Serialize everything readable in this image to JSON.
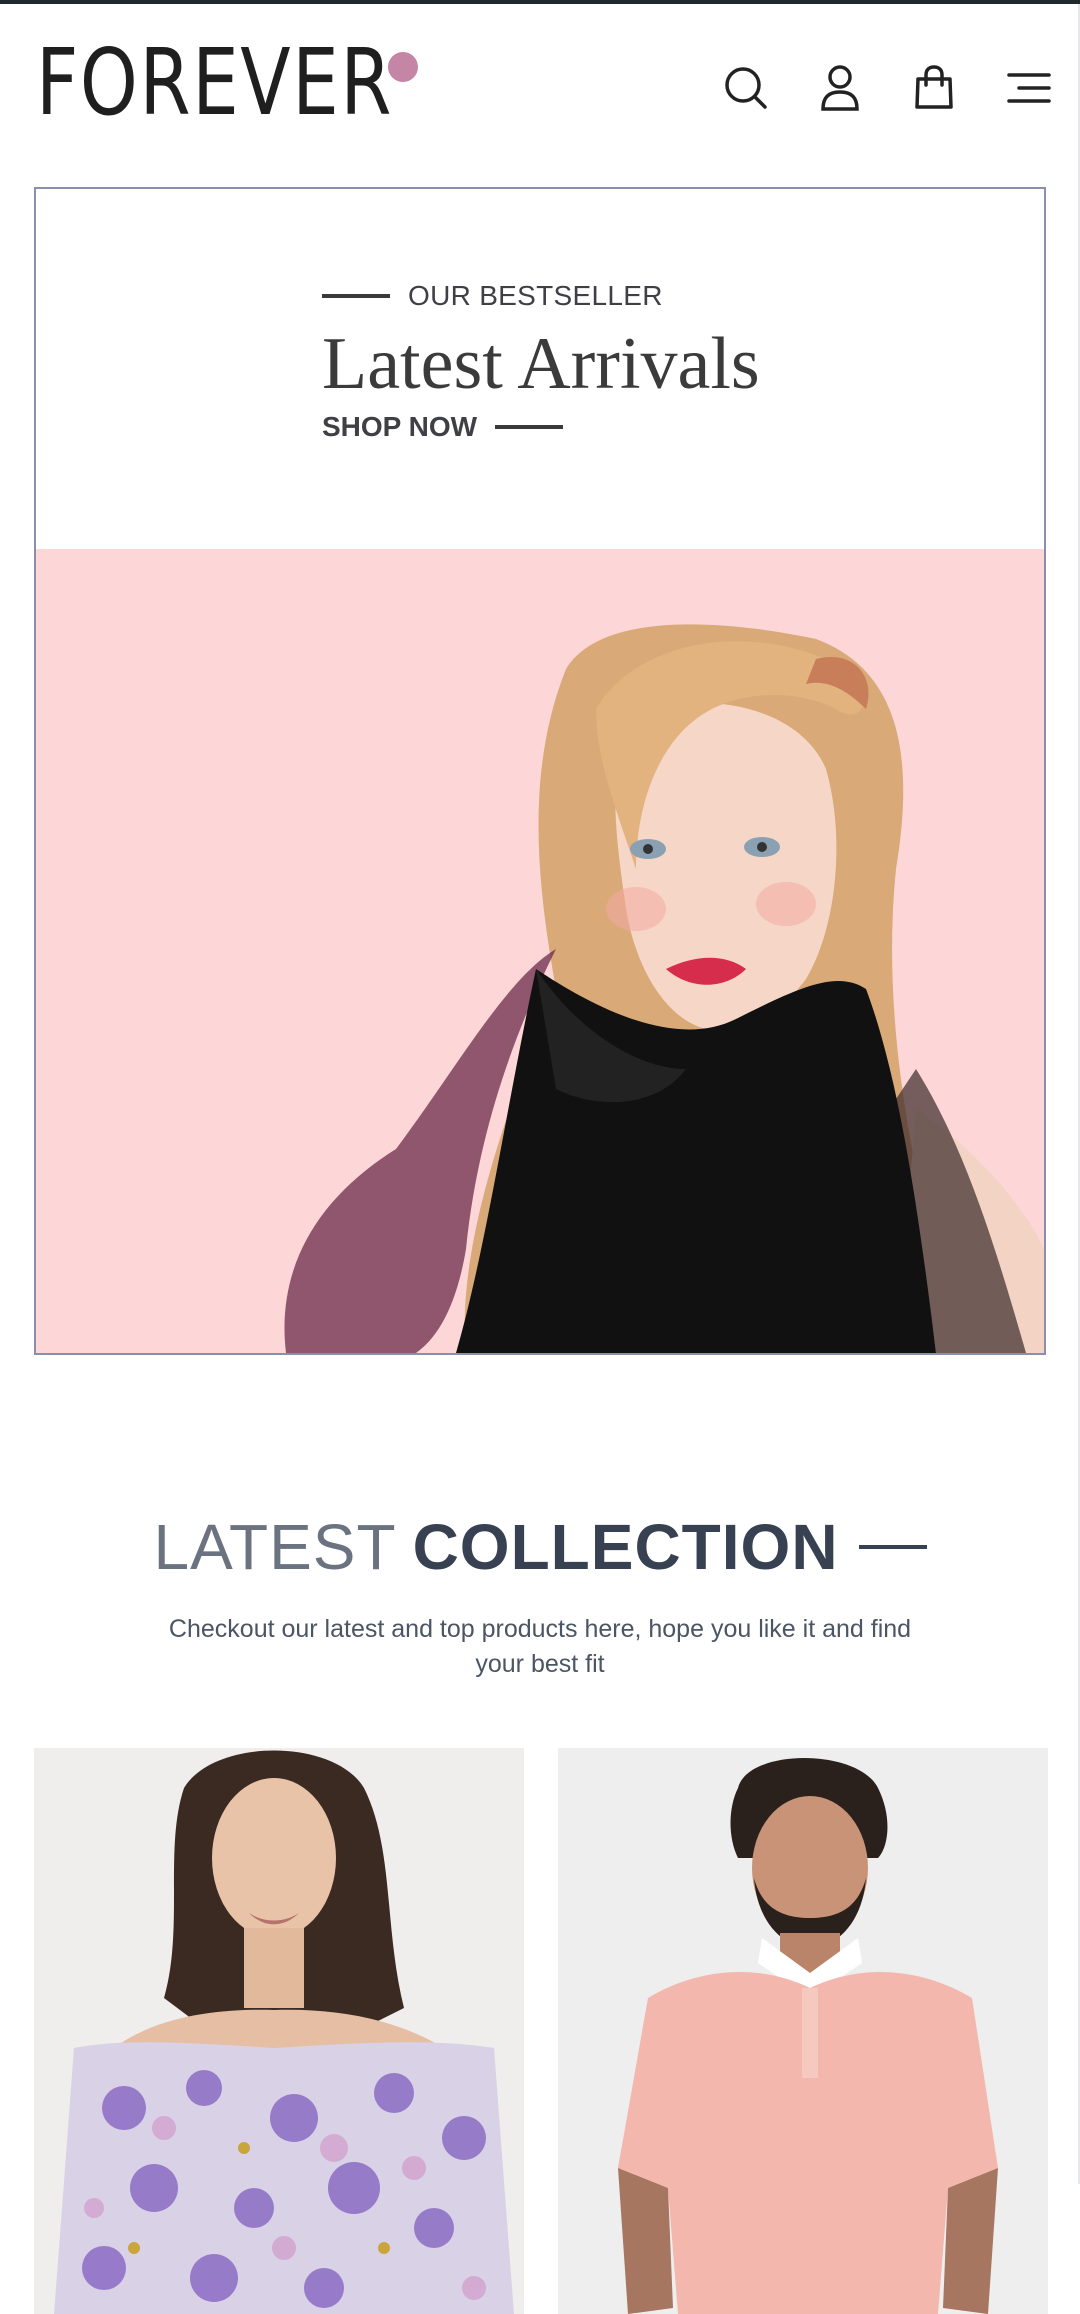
{
  "header": {
    "logo_text": "FOREVER",
    "icons": [
      "search-icon",
      "user-icon",
      "shopping-bag-icon",
      "menu-icon"
    ]
  },
  "hero": {
    "kicker": "OUR BESTSELLER",
    "title": "Latest Arrivals",
    "cta": "SHOP NOW"
  },
  "collection": {
    "title_light": "LATEST",
    "title_bold": "COLLECTION",
    "subtitle": "Checkout our latest and top products here, hope you like it and find your best fit"
  },
  "colors": {
    "accent_dot": "#c586a5",
    "hero_background": "#fdd6d7",
    "text_dark": "#374151"
  }
}
